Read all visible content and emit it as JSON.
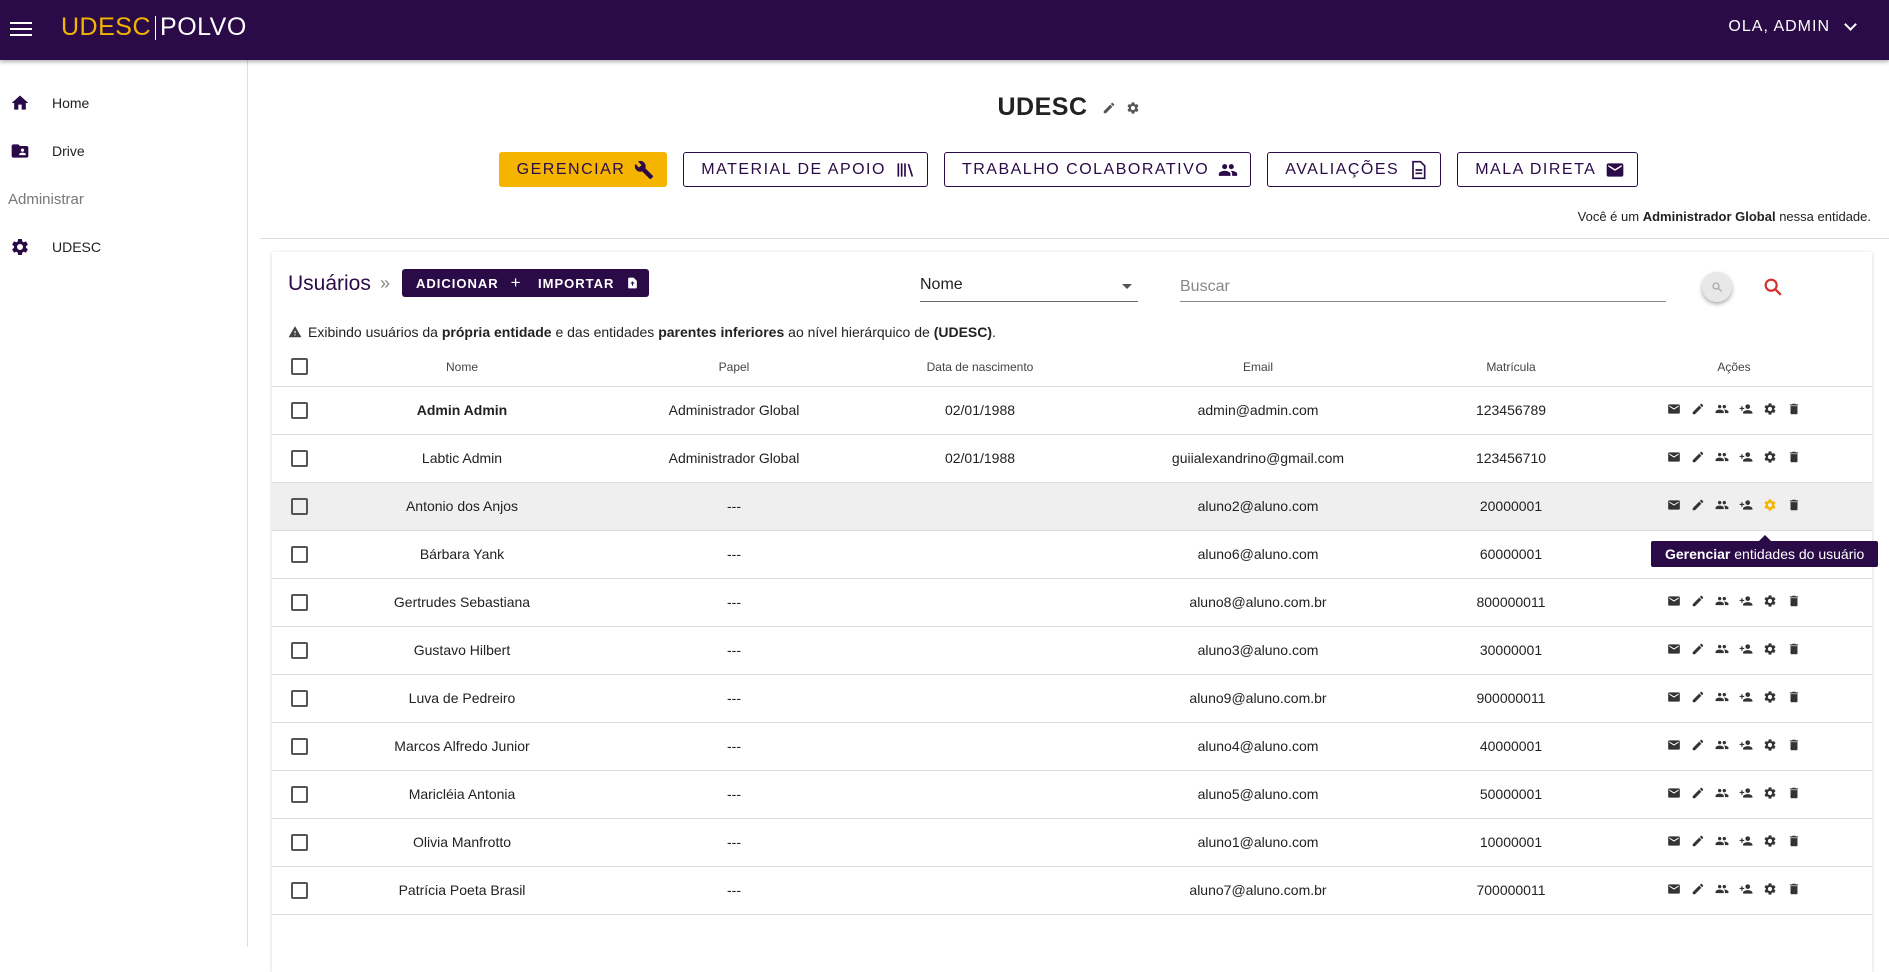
{
  "header": {
    "logo_left": "UDESC",
    "logo_right": "POLVO",
    "user_menu": "OLA, ADMIN"
  },
  "sidebar": {
    "items": [
      {
        "label": "Home",
        "icon": "home-icon"
      },
      {
        "label": "Drive",
        "icon": "folder-shared-icon"
      }
    ],
    "section_label": "Administrar",
    "admin_items": [
      {
        "label": "UDESC",
        "icon": "gear-icon"
      }
    ]
  },
  "entity": {
    "title": "UDESC"
  },
  "toolbar": {
    "buttons": [
      {
        "label": "GERENCIAR",
        "icon": "wrench-icon",
        "active": true
      },
      {
        "label": "MATERIAL DE APOIO",
        "icon": "library-icon"
      },
      {
        "label": "TRABALHO COLABORATIVO",
        "icon": "group-icon"
      },
      {
        "label": "AVALIAÇÕES",
        "icon": "document-icon"
      },
      {
        "label": "MALA DIRETA",
        "icon": "mail-icon"
      }
    ]
  },
  "notice": {
    "prefix": "Você é um ",
    "role": "Administrador Global",
    "suffix": " nessa entidade."
  },
  "users": {
    "title": "Usuários",
    "breadcrumb_sep": "»",
    "add_label": "ADICIONAR",
    "import_label": "IMPORTAR",
    "filter_value": "Nome",
    "search_placeholder": "Buscar",
    "info": {
      "t1": "Exibindo usuários da ",
      "b1": "própria entidade",
      "t2": " e das entidades ",
      "b2": "parentes inferiores",
      "t3": " ao nível hierárquico de ",
      "b3": "(UDESC)",
      "t4": "."
    },
    "columns": [
      "Nome",
      "Papel",
      "Data de nascimento",
      "Email",
      "Matrícula",
      "Ações"
    ],
    "rows": [
      {
        "nome": "Admin Admin",
        "papel": "Administrador Global",
        "nasc": "02/01/1988",
        "email": "admin@admin.com",
        "matricula": "123456789"
      },
      {
        "nome": "Labtic Admin",
        "papel": "Administrador Global",
        "nasc": "02/01/1988",
        "email": "guiialexandrino@gmail.com",
        "matricula": "123456710"
      },
      {
        "nome": "Antonio dos Anjos",
        "papel": "---",
        "nasc": "",
        "email": "aluno2@aluno.com",
        "matricula": "20000001"
      },
      {
        "nome": "Bárbara Yank",
        "papel": "---",
        "nasc": "",
        "email": "aluno6@aluno.com",
        "matricula": "60000001"
      },
      {
        "nome": "Gertrudes Sebastiana",
        "papel": "---",
        "nasc": "",
        "email": "aluno8@aluno.com.br",
        "matricula": "800000011"
      },
      {
        "nome": "Gustavo Hilbert",
        "papel": "---",
        "nasc": "",
        "email": "aluno3@aluno.com",
        "matricula": "30000001"
      },
      {
        "nome": "Luva de Pedreiro",
        "papel": "---",
        "nasc": "",
        "email": "aluno9@aluno.com.br",
        "matricula": "900000011"
      },
      {
        "nome": "Marcos Alfredo Junior",
        "papel": "---",
        "nasc": "",
        "email": "aluno4@aluno.com",
        "matricula": "40000001"
      },
      {
        "nome": "Maricléia Antonia",
        "papel": "---",
        "nasc": "",
        "email": "aluno5@aluno.com",
        "matricula": "50000001"
      },
      {
        "nome": "Olivia Manfrotto",
        "papel": "---",
        "nasc": "",
        "email": "aluno1@aluno.com",
        "matricula": "10000001"
      },
      {
        "nome": "Patrícia Poeta Brasil",
        "papel": "---",
        "nasc": "",
        "email": "aluno7@aluno.com.br",
        "matricula": "700000011"
      }
    ],
    "row_actions": [
      "mail-icon",
      "edit-icon",
      "group-icon",
      "person-add-icon",
      "gear-icon",
      "delete-icon"
    ]
  },
  "tooltip": {
    "bold": "Gerenciar",
    "rest": " entidades do usuário"
  }
}
